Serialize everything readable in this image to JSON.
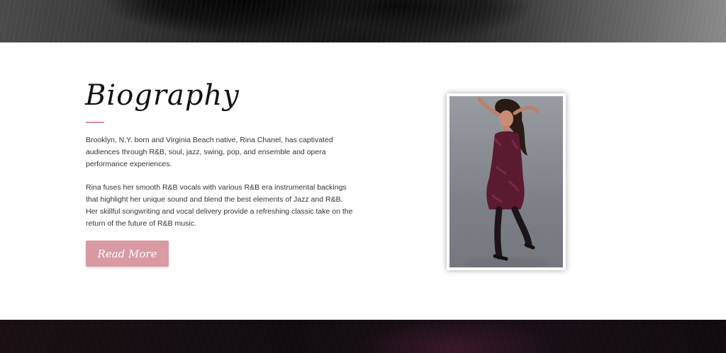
{
  "bio": {
    "title": "Biography",
    "paragraph_1": "Brooklyn, N.Y. born and Virginia Beach native, Rina Chanel, has captivated audiences through R&B, soul, jazz, swing, pop, and ensemble and opera performance experiences.",
    "paragraph_2": "Rina fuses her smooth R&B vocals with various R&B era instrumental backings that highlight her unique sound and blend the best elements of Jazz and R&B. Her skillful songwriting and vocal delivery provide a refreshing classic take on the return of the future of R&B music.",
    "read_more_label": "Read More"
  },
  "colors": {
    "accent": "#d99aa3",
    "divider": "#dc8f98",
    "text": "#333333",
    "heading": "#111111"
  }
}
